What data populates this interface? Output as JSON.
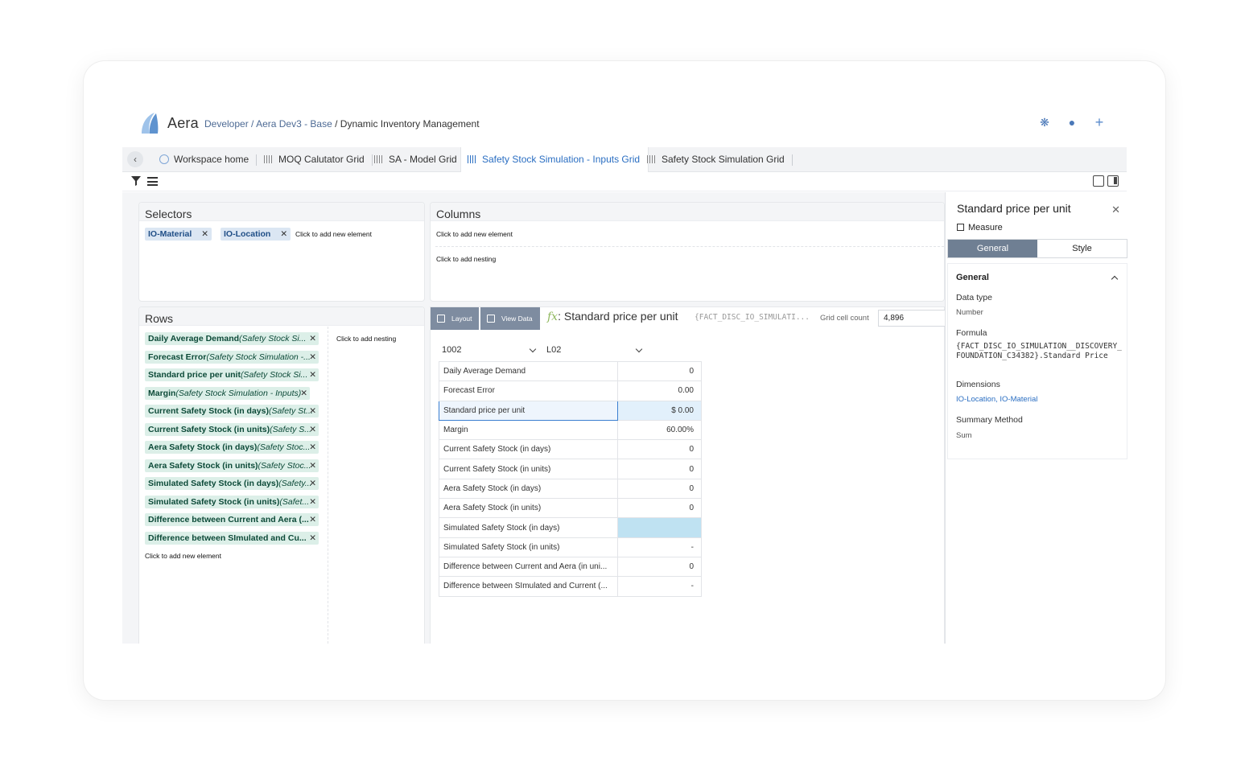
{
  "app": {
    "brand": "Aera",
    "breadcrumb": [
      "Developer",
      "Aera Dev3 - Base",
      "Dynamic Inventory Management"
    ],
    "top_icons": [
      "settings-icon",
      "mic-icon",
      "plus-icon"
    ]
  },
  "tabs": {
    "home": "Workspace home",
    "items": [
      "MOQ Calutator Grid",
      "SA - Model Grid",
      "Safety Stock Simulation - Inputs Grid",
      "Safety Stock Simulation Grid"
    ],
    "active_index": 2
  },
  "selectors": {
    "title": "Selectors",
    "chips": [
      "IO-Material",
      "IO-Location"
    ],
    "add": "Click to add new element"
  },
  "columns": {
    "title": "Columns",
    "add": "Click to add new element",
    "add_nesting": "Click to add nesting"
  },
  "rows": {
    "title": "Rows",
    "add": "Click to add new element",
    "add_nesting": "Click to add nesting",
    "items": [
      {
        "name": "Daily Average Demand",
        "ctx": "(Safety Stock Si..."
      },
      {
        "name": "Forecast Error",
        "ctx": "(Safety Stock Simulation -..."
      },
      {
        "name": "Standard price per unit",
        "ctx": "(Safety Stock Si..."
      },
      {
        "name": "Margin",
        "ctx": "(Safety Stock Simulation - Inputs)"
      },
      {
        "name": "Current Safety Stock (in days)",
        "ctx": "(Safety St..."
      },
      {
        "name": "Current Safety Stock (in units)",
        "ctx": "(Safety S..."
      },
      {
        "name": "Aera Safety Stock (in days)",
        "ctx": "(Safety Stoc..."
      },
      {
        "name": "Aera Safety Stock (in units)",
        "ctx": "(Safety Stoc..."
      },
      {
        "name": "Simulated Safety Stock (in days)",
        "ctx": "(Safety..."
      },
      {
        "name": "Simulated Safety Stock (in units)",
        "ctx": "(Safet..."
      },
      {
        "name": "Difference between Current and Aera (...",
        "ctx": ""
      },
      {
        "name": "Difference between SImulated and Cu...",
        "ctx": ""
      }
    ]
  },
  "main": {
    "layout_btn": "Layout",
    "view_data_btn": "View Data",
    "fx_symbol": "fx",
    "title": ": Standard price per unit",
    "formula_snippet": "{FACT_DISC_IO_SIMULATI...",
    "grid_cell_count_label": "Grid cell count",
    "grid_cell_count": "4,896",
    "select_material": "1002",
    "select_location": "L02",
    "grid": [
      {
        "label": "Daily Average Demand",
        "value": "0"
      },
      {
        "label": "Forecast Error",
        "value": "0.00"
      },
      {
        "label": "Standard price per unit",
        "value": "$ 0.00"
      },
      {
        "label": "Margin",
        "value": "60.00%"
      },
      {
        "label": "Current Safety Stock (in days)",
        "value": "0"
      },
      {
        "label": "Current Safety Stock (in units)",
        "value": "0"
      },
      {
        "label": "Aera Safety Stock (in days)",
        "value": "0"
      },
      {
        "label": "Aera Safety Stock (in units)",
        "value": "0"
      },
      {
        "label": "Simulated Safety Stock (in days)",
        "value": ""
      },
      {
        "label": "Simulated Safety Stock (in units)",
        "value": "-"
      },
      {
        "label": "Difference between Current and Aera (in uni...",
        "value": "0"
      },
      {
        "label": "Difference between SImulated and Current (...",
        "value": "-"
      }
    ],
    "selected_row": 2,
    "highlight_row": 8
  },
  "props": {
    "title": "Standard price per unit",
    "kind": "Measure",
    "tab_general": "General",
    "tab_style": "Style",
    "section": "General",
    "data_type_label": "Data type",
    "data_type": "Number",
    "formula_label": "Formula",
    "formula": "{FACT_DISC_IO_SIMULATION__DISCOVERY_FOUNDATION_C34382}.Standard Price",
    "dimensions_label": "Dimensions",
    "dimensions": "IO-Location, IO-Material",
    "summary_label": "Summary Method",
    "summary": "Sum"
  },
  "colors": {
    "accent": "#2a6ec2",
    "row_chip": "#dcefe8",
    "selector_chip": "#dbe6f3",
    "highlight_cell": "#bfe2f2"
  }
}
